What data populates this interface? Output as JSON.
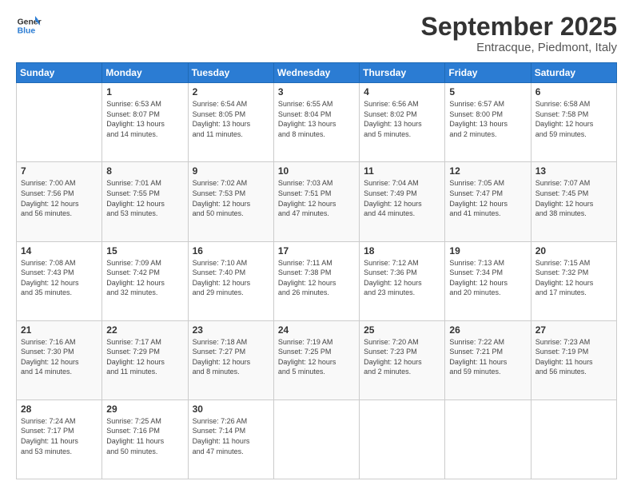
{
  "logo": {
    "line1": "General",
    "line2": "Blue"
  },
  "header": {
    "month": "September 2025",
    "location": "Entracque, Piedmont, Italy"
  },
  "days_of_week": [
    "Sunday",
    "Monday",
    "Tuesday",
    "Wednesday",
    "Thursday",
    "Friday",
    "Saturday"
  ],
  "weeks": [
    [
      {
        "day": "",
        "info": ""
      },
      {
        "day": "1",
        "info": "Sunrise: 6:53 AM\nSunset: 8:07 PM\nDaylight: 13 hours\nand 14 minutes."
      },
      {
        "day": "2",
        "info": "Sunrise: 6:54 AM\nSunset: 8:05 PM\nDaylight: 13 hours\nand 11 minutes."
      },
      {
        "day": "3",
        "info": "Sunrise: 6:55 AM\nSunset: 8:04 PM\nDaylight: 13 hours\nand 8 minutes."
      },
      {
        "day": "4",
        "info": "Sunrise: 6:56 AM\nSunset: 8:02 PM\nDaylight: 13 hours\nand 5 minutes."
      },
      {
        "day": "5",
        "info": "Sunrise: 6:57 AM\nSunset: 8:00 PM\nDaylight: 13 hours\nand 2 minutes."
      },
      {
        "day": "6",
        "info": "Sunrise: 6:58 AM\nSunset: 7:58 PM\nDaylight: 12 hours\nand 59 minutes."
      }
    ],
    [
      {
        "day": "7",
        "info": "Sunrise: 7:00 AM\nSunset: 7:56 PM\nDaylight: 12 hours\nand 56 minutes."
      },
      {
        "day": "8",
        "info": "Sunrise: 7:01 AM\nSunset: 7:55 PM\nDaylight: 12 hours\nand 53 minutes."
      },
      {
        "day": "9",
        "info": "Sunrise: 7:02 AM\nSunset: 7:53 PM\nDaylight: 12 hours\nand 50 minutes."
      },
      {
        "day": "10",
        "info": "Sunrise: 7:03 AM\nSunset: 7:51 PM\nDaylight: 12 hours\nand 47 minutes."
      },
      {
        "day": "11",
        "info": "Sunrise: 7:04 AM\nSunset: 7:49 PM\nDaylight: 12 hours\nand 44 minutes."
      },
      {
        "day": "12",
        "info": "Sunrise: 7:05 AM\nSunset: 7:47 PM\nDaylight: 12 hours\nand 41 minutes."
      },
      {
        "day": "13",
        "info": "Sunrise: 7:07 AM\nSunset: 7:45 PM\nDaylight: 12 hours\nand 38 minutes."
      }
    ],
    [
      {
        "day": "14",
        "info": "Sunrise: 7:08 AM\nSunset: 7:43 PM\nDaylight: 12 hours\nand 35 minutes."
      },
      {
        "day": "15",
        "info": "Sunrise: 7:09 AM\nSunset: 7:42 PM\nDaylight: 12 hours\nand 32 minutes."
      },
      {
        "day": "16",
        "info": "Sunrise: 7:10 AM\nSunset: 7:40 PM\nDaylight: 12 hours\nand 29 minutes."
      },
      {
        "day": "17",
        "info": "Sunrise: 7:11 AM\nSunset: 7:38 PM\nDaylight: 12 hours\nand 26 minutes."
      },
      {
        "day": "18",
        "info": "Sunrise: 7:12 AM\nSunset: 7:36 PM\nDaylight: 12 hours\nand 23 minutes."
      },
      {
        "day": "19",
        "info": "Sunrise: 7:13 AM\nSunset: 7:34 PM\nDaylight: 12 hours\nand 20 minutes."
      },
      {
        "day": "20",
        "info": "Sunrise: 7:15 AM\nSunset: 7:32 PM\nDaylight: 12 hours\nand 17 minutes."
      }
    ],
    [
      {
        "day": "21",
        "info": "Sunrise: 7:16 AM\nSunset: 7:30 PM\nDaylight: 12 hours\nand 14 minutes."
      },
      {
        "day": "22",
        "info": "Sunrise: 7:17 AM\nSunset: 7:29 PM\nDaylight: 12 hours\nand 11 minutes."
      },
      {
        "day": "23",
        "info": "Sunrise: 7:18 AM\nSunset: 7:27 PM\nDaylight: 12 hours\nand 8 minutes."
      },
      {
        "day": "24",
        "info": "Sunrise: 7:19 AM\nSunset: 7:25 PM\nDaylight: 12 hours\nand 5 minutes."
      },
      {
        "day": "25",
        "info": "Sunrise: 7:20 AM\nSunset: 7:23 PM\nDaylight: 12 hours\nand 2 minutes."
      },
      {
        "day": "26",
        "info": "Sunrise: 7:22 AM\nSunset: 7:21 PM\nDaylight: 11 hours\nand 59 minutes."
      },
      {
        "day": "27",
        "info": "Sunrise: 7:23 AM\nSunset: 7:19 PM\nDaylight: 11 hours\nand 56 minutes."
      }
    ],
    [
      {
        "day": "28",
        "info": "Sunrise: 7:24 AM\nSunset: 7:17 PM\nDaylight: 11 hours\nand 53 minutes."
      },
      {
        "day": "29",
        "info": "Sunrise: 7:25 AM\nSunset: 7:16 PM\nDaylight: 11 hours\nand 50 minutes."
      },
      {
        "day": "30",
        "info": "Sunrise: 7:26 AM\nSunset: 7:14 PM\nDaylight: 11 hours\nand 47 minutes."
      },
      {
        "day": "",
        "info": ""
      },
      {
        "day": "",
        "info": ""
      },
      {
        "day": "",
        "info": ""
      },
      {
        "day": "",
        "info": ""
      }
    ]
  ]
}
